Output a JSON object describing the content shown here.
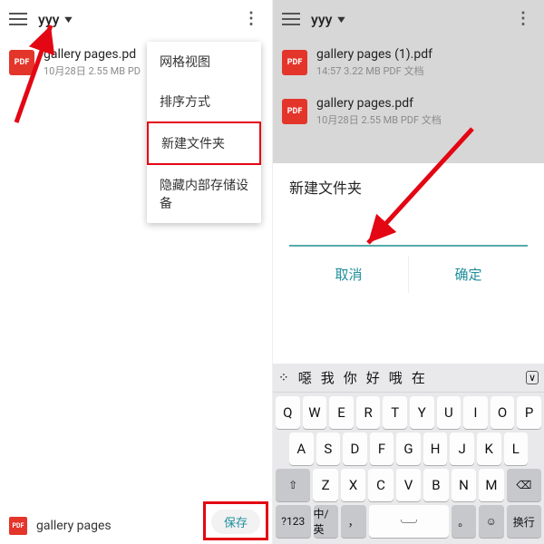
{
  "left": {
    "topbar": {
      "title": "yyy"
    },
    "file": {
      "name": "gallery pages.pd",
      "meta": "10月28日 2.55 MB PD"
    },
    "menu": {
      "items": [
        "网格视图",
        "排序方式",
        "新建文件夹",
        "隐藏内部存储设备"
      ]
    },
    "bottom": {
      "filename": "gallery pages",
      "save": "保存"
    }
  },
  "right": {
    "topbar": {
      "title": "yyy"
    },
    "files": [
      {
        "name": "gallery pages (1).pdf",
        "meta": "14:57 3.22 MB PDF 文档"
      },
      {
        "name": "gallery pages.pdf",
        "meta": "10月28日 2.55 MB PDF 文档"
      }
    ],
    "dialog": {
      "title": "新建文件夹",
      "cancel": "取消",
      "ok": "确定"
    },
    "keyboard": {
      "suggestions": [
        "噁",
        "我",
        "你",
        "好",
        "哦",
        "在"
      ],
      "row1": [
        "Q",
        "W",
        "E",
        "R",
        "T",
        "Y",
        "U",
        "I",
        "O",
        "P"
      ],
      "row2": [
        "A",
        "S",
        "D",
        "F",
        "G",
        "H",
        "J",
        "K",
        "L"
      ],
      "row3": [
        "Z",
        "X",
        "C",
        "V",
        "B",
        "N",
        "M"
      ],
      "shift": "⇧",
      "back": "⌫",
      "row4": {
        "sym": "?123",
        "lang": "中/英",
        "emoji": "☺",
        "enter": "换行"
      }
    }
  },
  "pdf_badge": "PDF"
}
